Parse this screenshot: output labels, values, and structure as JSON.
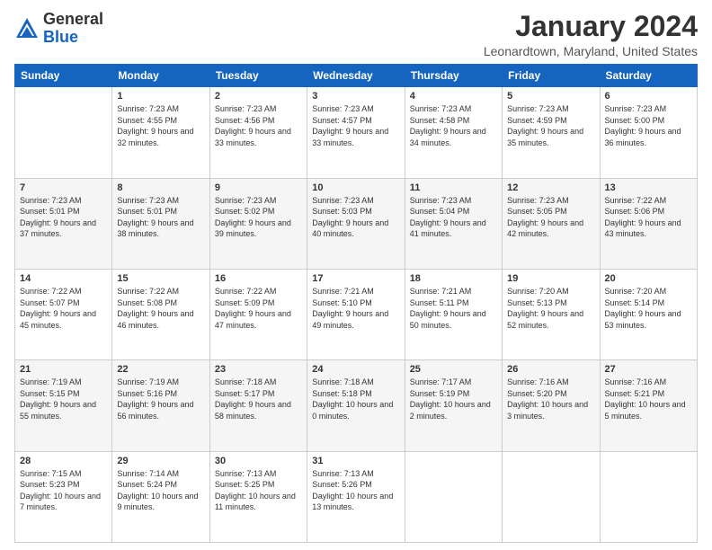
{
  "header": {
    "logo_general": "General",
    "logo_blue": "Blue",
    "month_title": "January 2024",
    "location": "Leonardtown, Maryland, United States"
  },
  "days_of_week": [
    "Sunday",
    "Monday",
    "Tuesday",
    "Wednesday",
    "Thursday",
    "Friday",
    "Saturday"
  ],
  "weeks": [
    [
      {
        "day": "",
        "sunrise": "",
        "sunset": "",
        "daylight": ""
      },
      {
        "day": "1",
        "sunrise": "Sunrise: 7:23 AM",
        "sunset": "Sunset: 4:55 PM",
        "daylight": "Daylight: 9 hours and 32 minutes."
      },
      {
        "day": "2",
        "sunrise": "Sunrise: 7:23 AM",
        "sunset": "Sunset: 4:56 PM",
        "daylight": "Daylight: 9 hours and 33 minutes."
      },
      {
        "day": "3",
        "sunrise": "Sunrise: 7:23 AM",
        "sunset": "Sunset: 4:57 PM",
        "daylight": "Daylight: 9 hours and 33 minutes."
      },
      {
        "day": "4",
        "sunrise": "Sunrise: 7:23 AM",
        "sunset": "Sunset: 4:58 PM",
        "daylight": "Daylight: 9 hours and 34 minutes."
      },
      {
        "day": "5",
        "sunrise": "Sunrise: 7:23 AM",
        "sunset": "Sunset: 4:59 PM",
        "daylight": "Daylight: 9 hours and 35 minutes."
      },
      {
        "day": "6",
        "sunrise": "Sunrise: 7:23 AM",
        "sunset": "Sunset: 5:00 PM",
        "daylight": "Daylight: 9 hours and 36 minutes."
      }
    ],
    [
      {
        "day": "7",
        "sunrise": "Sunrise: 7:23 AM",
        "sunset": "Sunset: 5:01 PM",
        "daylight": "Daylight: 9 hours and 37 minutes."
      },
      {
        "day": "8",
        "sunrise": "Sunrise: 7:23 AM",
        "sunset": "Sunset: 5:01 PM",
        "daylight": "Daylight: 9 hours and 38 minutes."
      },
      {
        "day": "9",
        "sunrise": "Sunrise: 7:23 AM",
        "sunset": "Sunset: 5:02 PM",
        "daylight": "Daylight: 9 hours and 39 minutes."
      },
      {
        "day": "10",
        "sunrise": "Sunrise: 7:23 AM",
        "sunset": "Sunset: 5:03 PM",
        "daylight": "Daylight: 9 hours and 40 minutes."
      },
      {
        "day": "11",
        "sunrise": "Sunrise: 7:23 AM",
        "sunset": "Sunset: 5:04 PM",
        "daylight": "Daylight: 9 hours and 41 minutes."
      },
      {
        "day": "12",
        "sunrise": "Sunrise: 7:23 AM",
        "sunset": "Sunset: 5:05 PM",
        "daylight": "Daylight: 9 hours and 42 minutes."
      },
      {
        "day": "13",
        "sunrise": "Sunrise: 7:22 AM",
        "sunset": "Sunset: 5:06 PM",
        "daylight": "Daylight: 9 hours and 43 minutes."
      }
    ],
    [
      {
        "day": "14",
        "sunrise": "Sunrise: 7:22 AM",
        "sunset": "Sunset: 5:07 PM",
        "daylight": "Daylight: 9 hours and 45 minutes."
      },
      {
        "day": "15",
        "sunrise": "Sunrise: 7:22 AM",
        "sunset": "Sunset: 5:08 PM",
        "daylight": "Daylight: 9 hours and 46 minutes."
      },
      {
        "day": "16",
        "sunrise": "Sunrise: 7:22 AM",
        "sunset": "Sunset: 5:09 PM",
        "daylight": "Daylight: 9 hours and 47 minutes."
      },
      {
        "day": "17",
        "sunrise": "Sunrise: 7:21 AM",
        "sunset": "Sunset: 5:10 PM",
        "daylight": "Daylight: 9 hours and 49 minutes."
      },
      {
        "day": "18",
        "sunrise": "Sunrise: 7:21 AM",
        "sunset": "Sunset: 5:11 PM",
        "daylight": "Daylight: 9 hours and 50 minutes."
      },
      {
        "day": "19",
        "sunrise": "Sunrise: 7:20 AM",
        "sunset": "Sunset: 5:13 PM",
        "daylight": "Daylight: 9 hours and 52 minutes."
      },
      {
        "day": "20",
        "sunrise": "Sunrise: 7:20 AM",
        "sunset": "Sunset: 5:14 PM",
        "daylight": "Daylight: 9 hours and 53 minutes."
      }
    ],
    [
      {
        "day": "21",
        "sunrise": "Sunrise: 7:19 AM",
        "sunset": "Sunset: 5:15 PM",
        "daylight": "Daylight: 9 hours and 55 minutes."
      },
      {
        "day": "22",
        "sunrise": "Sunrise: 7:19 AM",
        "sunset": "Sunset: 5:16 PM",
        "daylight": "Daylight: 9 hours and 56 minutes."
      },
      {
        "day": "23",
        "sunrise": "Sunrise: 7:18 AM",
        "sunset": "Sunset: 5:17 PM",
        "daylight": "Daylight: 9 hours and 58 minutes."
      },
      {
        "day": "24",
        "sunrise": "Sunrise: 7:18 AM",
        "sunset": "Sunset: 5:18 PM",
        "daylight": "Daylight: 10 hours and 0 minutes."
      },
      {
        "day": "25",
        "sunrise": "Sunrise: 7:17 AM",
        "sunset": "Sunset: 5:19 PM",
        "daylight": "Daylight: 10 hours and 2 minutes."
      },
      {
        "day": "26",
        "sunrise": "Sunrise: 7:16 AM",
        "sunset": "Sunset: 5:20 PM",
        "daylight": "Daylight: 10 hours and 3 minutes."
      },
      {
        "day": "27",
        "sunrise": "Sunrise: 7:16 AM",
        "sunset": "Sunset: 5:21 PM",
        "daylight": "Daylight: 10 hours and 5 minutes."
      }
    ],
    [
      {
        "day": "28",
        "sunrise": "Sunrise: 7:15 AM",
        "sunset": "Sunset: 5:23 PM",
        "daylight": "Daylight: 10 hours and 7 minutes."
      },
      {
        "day": "29",
        "sunrise": "Sunrise: 7:14 AM",
        "sunset": "Sunset: 5:24 PM",
        "daylight": "Daylight: 10 hours and 9 minutes."
      },
      {
        "day": "30",
        "sunrise": "Sunrise: 7:13 AM",
        "sunset": "Sunset: 5:25 PM",
        "daylight": "Daylight: 10 hours and 11 minutes."
      },
      {
        "day": "31",
        "sunrise": "Sunrise: 7:13 AM",
        "sunset": "Sunset: 5:26 PM",
        "daylight": "Daylight: 10 hours and 13 minutes."
      },
      {
        "day": "",
        "sunrise": "",
        "sunset": "",
        "daylight": ""
      },
      {
        "day": "",
        "sunrise": "",
        "sunset": "",
        "daylight": ""
      },
      {
        "day": "",
        "sunrise": "",
        "sunset": "",
        "daylight": ""
      }
    ]
  ]
}
